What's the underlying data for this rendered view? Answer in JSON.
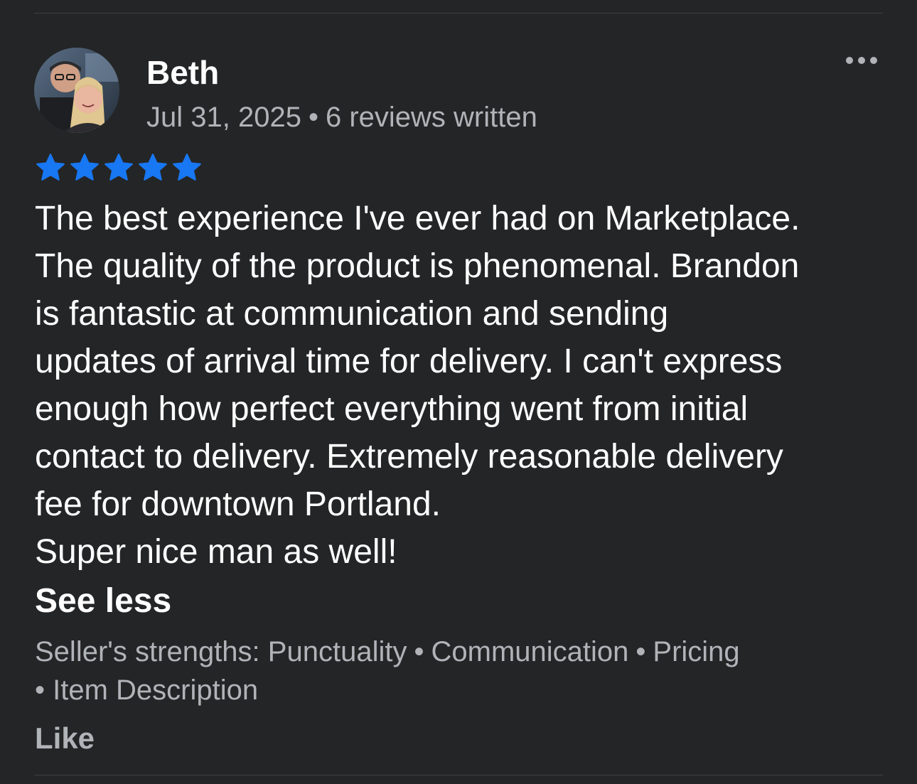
{
  "review": {
    "reviewer_name": "Beth",
    "date": "Jul 31, 2025",
    "separator": "•",
    "reviews_written": "6 reviews written",
    "rating": 5,
    "rating_max": 5,
    "star_color": "#1877f2",
    "body_lines": [
      "The best experience I've ever had on Marketplace.",
      "The quality of the product is phenomenal. Brandon",
      "is fantastic at communication and sending",
      "updates of arrival time for delivery. I can't express",
      "enough how perfect everything went from initial",
      "contact to delivery. Extremely reasonable delivery",
      "fee for downtown Portland.",
      "Super nice man as well!"
    ],
    "see_less_label": "See less",
    "strengths_label": "Seller's strengths:",
    "strengths": [
      "Punctuality",
      "Communication",
      "Pricing",
      "Item Description"
    ],
    "like_label": "Like"
  },
  "icons": {
    "more": "more-horizontal-icon",
    "star": "star-icon"
  },
  "colors": {
    "background": "#242526",
    "primary_text": "#ffffff",
    "secondary_text": "#b0b3b8",
    "divider": "#3e4042",
    "accent": "#1877f2"
  }
}
